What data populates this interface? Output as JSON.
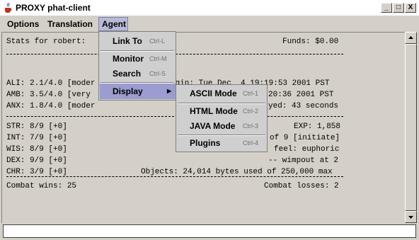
{
  "window": {
    "title": "PROXY phat-client",
    "minimize": "_",
    "maximize": "□",
    "close": "X"
  },
  "menubar": {
    "options": "Options",
    "translation": "Translation",
    "agent": "Agent"
  },
  "agent_menu": {
    "link_to": {
      "label": "Link To",
      "shortcut": "Ctrl-L"
    },
    "monitor": {
      "label": "Monitor",
      "shortcut": "Ctrl-M"
    },
    "search": {
      "label": "Search",
      "shortcut": "Ctrl-S"
    },
    "display": {
      "label": "Display",
      "arrow": "▶"
    }
  },
  "display_submenu": {
    "ascii": {
      "label": "ASCII Mode",
      "shortcut": "Ctrl-1"
    },
    "html": {
      "label": "HTML Mode",
      "shortcut": "Ctrl-2"
    },
    "java": {
      "label": "JAVA Mode",
      "shortcut": "Ctrl-3"
    },
    "plugins": {
      "label": "Plugins",
      "shortcut": "Ctrl-4"
    }
  },
  "stats": {
    "header_left": "Stats for robert:",
    "funds": "Funds: $0.00",
    "ali_left": "ALI: 2.1/4.0 [moder",
    "ali_right": "ogin: Tue Dec  4 19:19:53 2001 PST",
    "amb_left": "AMB: 3.5/4.0 [very",
    "amb_right": "Time: Tue Dec  4 19:20:36 2001 PST",
    "anx_left": "ANX: 1.8/4.0 [moder",
    "anx_right": "yed: 43 seconds",
    "str_left": "STR: 8/9 [+0]",
    "str_right": "EXP: 1,858",
    "int_left": "INT: 7/9 [+0]",
    "int_right": "of 9 [initiate]",
    "wis_left": "WIS: 8/9 [+0]",
    "wis_right": "feel: euphoric",
    "dex_left": "DEX: 9/9 [+0]",
    "dex_right": "-- wimpout at 2",
    "chr_left": "CHR: 3/9 [+0]",
    "chr_right": "Objects: 24,014 bytes used of 250,000 max",
    "combat_wins": "Combat wins: 25",
    "combat_losses": "Combat losses: 2"
  },
  "colors": {
    "highlight": "#9c9cd0",
    "window_bg": "#d4d0c8"
  }
}
